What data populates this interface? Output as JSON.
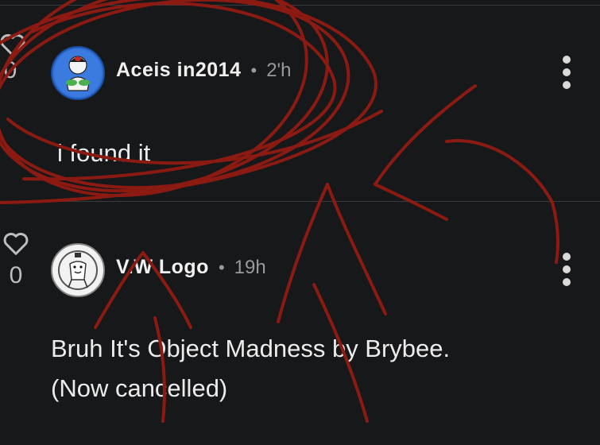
{
  "comments": [
    {
      "username": "Aceis in2014",
      "separator": "•",
      "time": "2'h",
      "likes": "0",
      "text": "i found it",
      "avatar_icon": "cartoon-character-avatar-icon"
    },
    {
      "username": "V.W Logo",
      "separator": "•",
      "time": "19h",
      "likes": "0",
      "text_line1": "Bruh It's Object Madness by Brybee.",
      "text_line2": "(Now cancelled)",
      "avatar_icon": "white-object-character-avatar-icon"
    }
  ],
  "colors": {
    "background": "#17181a",
    "scribble": "#8b1a12",
    "avatar_blue": "#2f6fd6"
  }
}
